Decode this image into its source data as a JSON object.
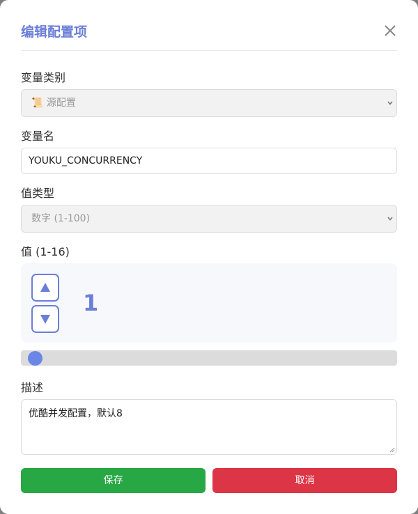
{
  "dialog": {
    "title": "编辑配置项",
    "close_glyph": "✕"
  },
  "form": {
    "category": {
      "label": "变量类别",
      "icon": "📜",
      "value": "源配置"
    },
    "name": {
      "label": "变量名",
      "value": "YOUKU_CONCURRENCY"
    },
    "value_type": {
      "label": "值类型",
      "value": "数字 (1-100)"
    },
    "value": {
      "label": "值 (1-16)",
      "current": "1",
      "min": 1,
      "max": 16,
      "slider_level": 0
    },
    "description": {
      "label": "描述",
      "value": "优酷并发配置，默认8"
    }
  },
  "actions": {
    "save_label": "保存",
    "cancel_label": "取消"
  },
  "colors": {
    "accent": "#6b7fd7",
    "save": "#28a745",
    "cancel": "#dc3545"
  }
}
